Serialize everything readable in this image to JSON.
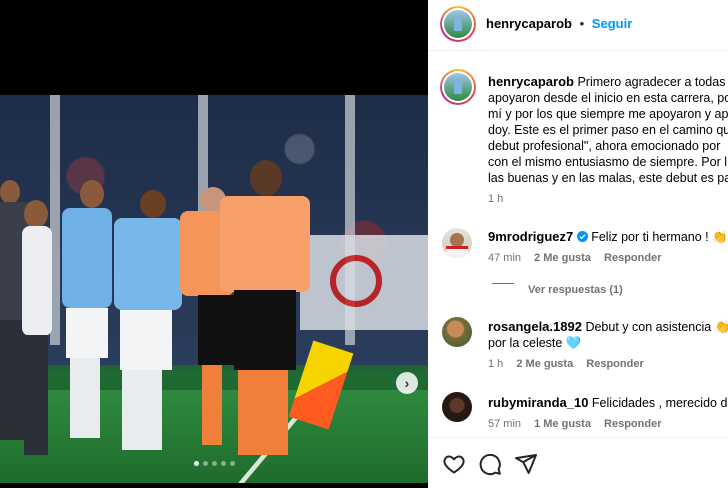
{
  "post": {
    "username": "henrycaparob",
    "follow_label": "Seguir",
    "separator": "•"
  },
  "caption": {
    "username": "henrycaparob",
    "lines": [
      "Primero agradecer a todas l",
      "apoyaron desde el inicio en esta carrera, po",
      "mí y por los que siempre me apoyaron y ap",
      "doy. Este es el primer paso en el camino qu",
      "debut profesional\", ahora emocionado por",
      "con el mismo entusiasmo de siempre. Por l",
      "las buenas y en las malas, este debut es pa"
    ],
    "time": "1 h"
  },
  "comments": [
    {
      "username": "9mrodriguez7",
      "verified": true,
      "text": "Feliz por ti hermano ! ",
      "emoji": "👏",
      "time": "47 min",
      "likes": "2 Me gusta",
      "reply": "Responder",
      "view_replies": "Ver respuestas (1)"
    },
    {
      "username": "rosangela.1892",
      "text_line1": "Debut y con asistencia ",
      "emoji1": "👏",
      "text_line2": "por la celeste ",
      "emoji2": "🩵",
      "time": "1 h",
      "likes": "2 Me gusta",
      "reply": "Responder"
    },
    {
      "username": "rubymiranda_10",
      "text": "Felicidades , merecido deb",
      "time": "57 min",
      "likes": "1 Me gusta",
      "reply": "Responder"
    }
  ],
  "icons": {
    "next": "chevron-right-icon",
    "like": "heart-icon",
    "comment": "comment-icon",
    "share": "send-icon",
    "verified": "verified-badge-icon"
  },
  "carousel": {
    "count": 5,
    "active": 1
  },
  "colors": {
    "link": "#0095f6",
    "verified": "#0095f6",
    "muted": "#737373"
  }
}
